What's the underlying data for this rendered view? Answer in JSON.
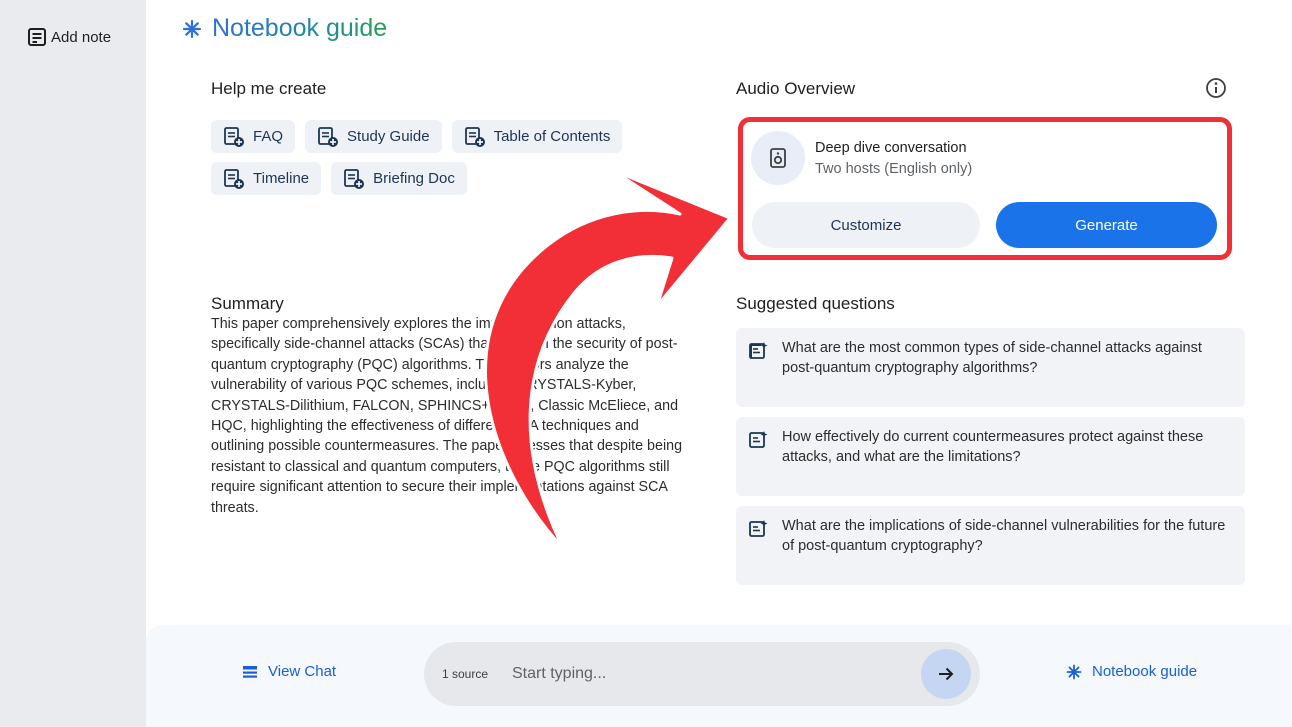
{
  "sidebar": {
    "add_note_label": "Add note"
  },
  "guide": {
    "title": "Notebook guide"
  },
  "help_create": {
    "heading": "Help me create",
    "chips": [
      "FAQ",
      "Study Guide",
      "Table of Contents",
      "Timeline",
      "Briefing Doc"
    ]
  },
  "summary": {
    "heading": "Summary",
    "text": "This paper comprehensively explores the implementation attacks, specifically side-channel attacks (SCAs) that threaten the security of post-quantum cryptography (PQC) algorithms. The authors analyze the vulnerability of various PQC schemes, including CRYSTALS-Kyber, CRYSTALS-Dilithium, FALCON, SPHINCS+, BIKE, Classic McEliece, and HQC, highlighting the effectiveness of different SCA techniques and outlining possible countermeasures. The paper stresses that despite being resistant to classical and quantum computers, these PQC algorithms still require significant attention to secure their implementations against SCA threats."
  },
  "audio": {
    "heading": "Audio Overview",
    "title": "Deep dive conversation",
    "subtitle": "Two hosts (English only)",
    "customize_label": "Customize",
    "generate_label": "Generate"
  },
  "suggested": {
    "heading": "Suggested questions",
    "questions": [
      "What are the most common types of side-channel attacks against post-quantum cryptography algorithms?",
      "How effectively do current countermeasures protect against these attacks, and what are the limitations?",
      "What are the implications of side-channel vulnerabilities for the future of post-quantum cryptography?"
    ]
  },
  "bottom": {
    "view_chat_label": "View Chat",
    "source_count": "1 source",
    "input_placeholder": "Start typing...",
    "notebook_guide_label": "Notebook guide"
  },
  "colors": {
    "accent_blue": "#1a73e8",
    "highlight_red": "#f22f36",
    "sidebar_bg": "#e9ebee"
  }
}
